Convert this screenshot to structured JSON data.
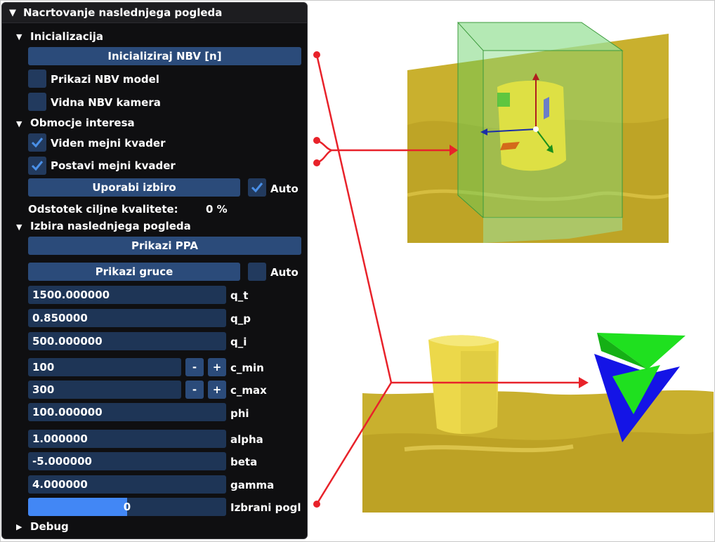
{
  "window": {
    "title": "Nacrtovanje naslednjega pogleda"
  },
  "sections": {
    "init": {
      "header": "Inicializacija",
      "init_button": "Inicializiraj NBV [n]",
      "show_model_label": "Prikazi NBV model",
      "show_model_checked": false,
      "visible_camera_label": "Vidna NBV kamera",
      "visible_camera_checked": false
    },
    "roi": {
      "header": "Obmocje interesa",
      "visible_box_label": "Viden mejni kvader",
      "visible_box_checked": true,
      "set_box_label": "Postavi mejni kvader",
      "set_box_checked": true,
      "use_selection_button": "Uporabi izbiro",
      "auto_label": "Auto",
      "auto_checked": true,
      "quality_label": "Odstotek ciljne kvalitete:",
      "quality_value": "0 %"
    },
    "selection": {
      "header": "Izbira naslednjega pogleda",
      "show_ppa_button": "Prikazi PPA",
      "show_clusters_button": "Prikazi gruce",
      "clusters_auto_label": "Auto",
      "clusters_auto_checked": false,
      "params": [
        {
          "value": "1500.000000",
          "label": "q_t"
        },
        {
          "value": "0.850000",
          "label": "q_p"
        },
        {
          "value": "500.000000",
          "label": "q_i"
        }
      ],
      "steppers": [
        {
          "value": "100",
          "label": "c_min",
          "minus": "-",
          "plus": "+"
        },
        {
          "value": "300",
          "label": "c_max",
          "minus": "-",
          "plus": "+"
        }
      ],
      "phi": {
        "value": "100.000000",
        "label": "phi"
      },
      "params2": [
        {
          "value": "1.000000",
          "label": "alpha"
        },
        {
          "value": "-5.000000",
          "label": "beta"
        },
        {
          "value": "4.000000",
          "label": "gamma"
        }
      ],
      "chosen_view": {
        "value": "0",
        "label": "Izbrani pogl",
        "progress_fraction": 0.5
      }
    },
    "debug": {
      "header": "Debug"
    }
  },
  "colors": {
    "panel_bg": "#0f0f11",
    "button": "#2b4b7a",
    "field": "#1e3556",
    "checkbox": "#223a5e",
    "checkmark": "#4a90e8",
    "progress": "#4287f5",
    "annotation": "#e8222a",
    "terrain": "#c9b02e",
    "bounding_box": "#5fd35f",
    "camera_green": "#1fe01f",
    "camera_blue": "#1414e6"
  },
  "icons": [
    "collapse-triangle-icon",
    "expand-triangle-icon",
    "checkmark-icon"
  ]
}
